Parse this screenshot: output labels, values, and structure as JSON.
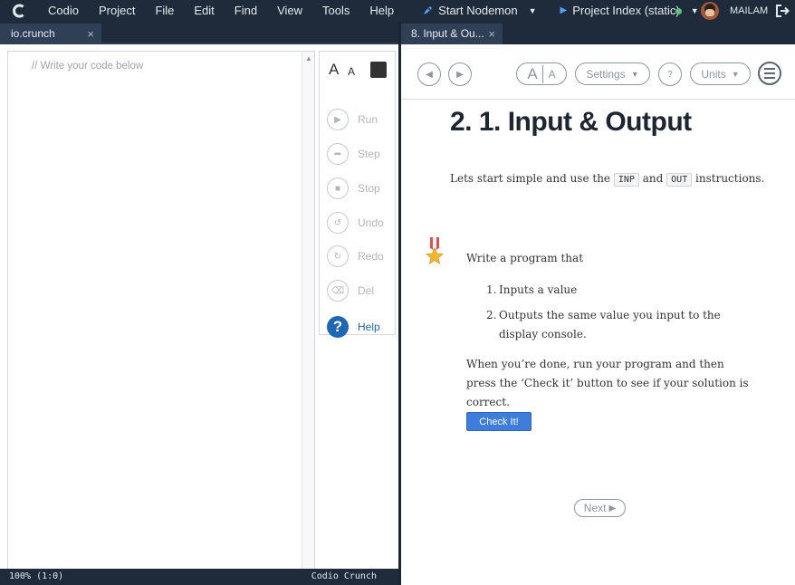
{
  "menubar": {
    "items": [
      "Codio",
      "Project",
      "File",
      "Edit",
      "Find",
      "View",
      "Tools",
      "Help"
    ],
    "run_start": "Start Nodemon",
    "run_preview": "Project Index (static)",
    "user": "MAILAM"
  },
  "editor": {
    "tab_label": "io.crunch",
    "tab_close": "×",
    "placeholder_comment": "// Write your code below",
    "font_large": "A",
    "font_small": "A",
    "tools": [
      "Run",
      "Step",
      "Stop",
      "Undo",
      "Redo",
      "Del",
      "Help"
    ],
    "status_left": "100%  (1:0)",
    "status_right": "Codio Crunch"
  },
  "guide": {
    "tab_label": "8. Input & Ou...",
    "tab_close": "×",
    "font_large": "A",
    "font_small": "A",
    "settings": "Settings",
    "help_q": "?",
    "units": "Units",
    "title": "2. 1. Input & Output",
    "intro_before": "Lets start simple and use the",
    "code_inp": "INP",
    "intro_and": "and",
    "code_out": "OUT",
    "intro_after": "instructions.",
    "task_lead": "Write a program that",
    "task_items": [
      {
        "num": "1.",
        "text": "Inputs a value"
      },
      {
        "num": "2.",
        "text": "Outputs the same value you input to the display console."
      }
    ],
    "task_done": "When you’re done, run your program and then press the ‘Check it’ button to see if your solution is correct.",
    "check_button": "Check It!",
    "next_button": "Next"
  },
  "colors": {
    "topbar": "#1f2b3a",
    "accent_blue": "#1f67b5",
    "check_button": "#3f7ddc",
    "status_online": "#5ec27a"
  }
}
